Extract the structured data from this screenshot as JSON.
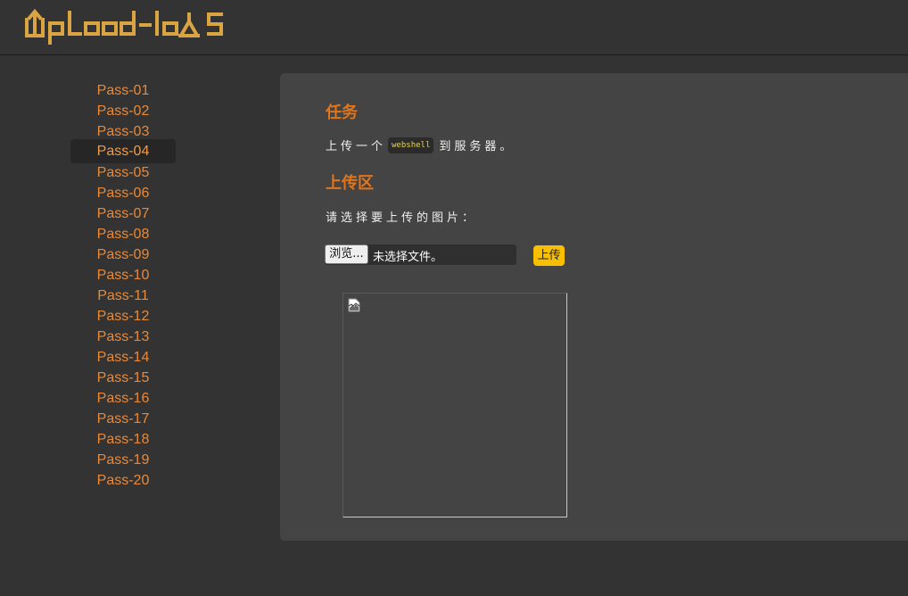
{
  "header": {
    "logo_text": "Upload-labs"
  },
  "sidebar": {
    "active_index": 3,
    "items": [
      {
        "label": "Pass-01"
      },
      {
        "label": "Pass-02"
      },
      {
        "label": "Pass-03"
      },
      {
        "label": "Pass-04"
      },
      {
        "label": "Pass-05"
      },
      {
        "label": "Pass-06"
      },
      {
        "label": "Pass-07"
      },
      {
        "label": "Pass-08"
      },
      {
        "label": "Pass-09"
      },
      {
        "label": "Pass-10"
      },
      {
        "label": "Pass-11"
      },
      {
        "label": "Pass-12"
      },
      {
        "label": "Pass-13"
      },
      {
        "label": "Pass-14"
      },
      {
        "label": "Pass-15"
      },
      {
        "label": "Pass-16"
      },
      {
        "label": "Pass-17"
      },
      {
        "label": "Pass-18"
      },
      {
        "label": "Pass-19"
      },
      {
        "label": "Pass-20"
      }
    ]
  },
  "main": {
    "task_title": "任务",
    "task_text_before": "上传一个",
    "task_code": "webshell",
    "task_text_after": "到服务器。",
    "upload_title": "上传区",
    "upload_prompt": "请选择要上传的图片：",
    "browse_label": "浏览...",
    "file_status": "未选择文件。",
    "upload_button": "上传",
    "preview_icon": "broken-image-icon"
  },
  "colors": {
    "background": "#333333",
    "panel": "#444444",
    "menu_text": "#e8893a",
    "title": "#e2741c",
    "logo": "#d9a441",
    "upload_button": "#f8c000"
  }
}
